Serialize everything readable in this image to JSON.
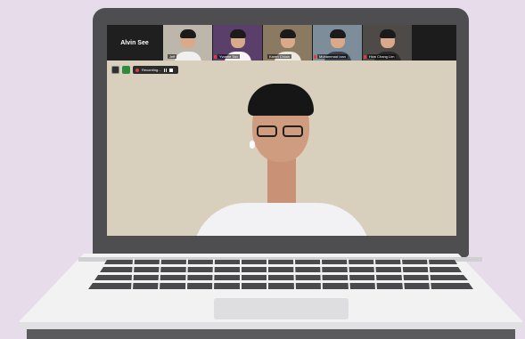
{
  "meeting": {
    "self_name": "Alvin See",
    "participants": [
      {
        "label": "Jeff"
      },
      {
        "label": "Yvonne Tan"
      },
      {
        "label": "Karen Chiow"
      },
      {
        "label": "Muhammad Izan"
      },
      {
        "label": "How Chang Lim"
      }
    ],
    "recording_label": "Recording..."
  },
  "colors": {
    "background": "#e6dcea",
    "laptop_frame": "#4e4e51",
    "recording_red": "#e23b3b",
    "status_green": "#2e8b3a"
  },
  "icons": [
    "microphone-muted-icon",
    "record-dot-icon",
    "pause-icon",
    "stop-icon",
    "shield-icon"
  ]
}
